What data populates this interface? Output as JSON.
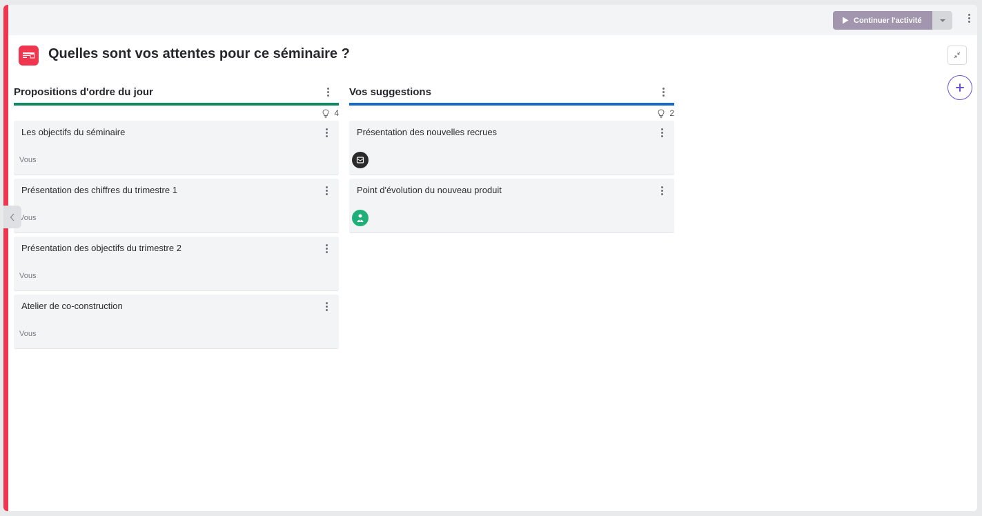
{
  "topbar": {
    "continue_label": "Continuer l'activité"
  },
  "page": {
    "title": "Quelles sont vos attentes pour ce séminaire ?"
  },
  "colors": {
    "accent": "#f0354e",
    "continue_button": "#a296ae",
    "column1_bar": "#0f8a5f",
    "column2_bar": "#1769c4",
    "add_button": "#6b4fd8"
  },
  "columns": [
    {
      "title": "Propositions d'ordre du jour",
      "count": "4",
      "cards": [
        {
          "title": "Les objectifs du séminaire",
          "author": "Vous"
        },
        {
          "title": "Présentation des chiffres du trimestre 1",
          "author": "Vous"
        },
        {
          "title": "Présentation des objectifs du trimestre 2",
          "author": "Vous"
        },
        {
          "title": "Atelier de co-construction",
          "author": "Vous"
        }
      ]
    },
    {
      "title": "Vos suggestions",
      "count": "2",
      "cards": [
        {
          "title": "Présentation des nouvelles recrues",
          "avatar": "dark-avatar-icon"
        },
        {
          "title": "Point d'évolution du nouveau produit",
          "avatar": "green-avatar-icon"
        }
      ]
    }
  ]
}
